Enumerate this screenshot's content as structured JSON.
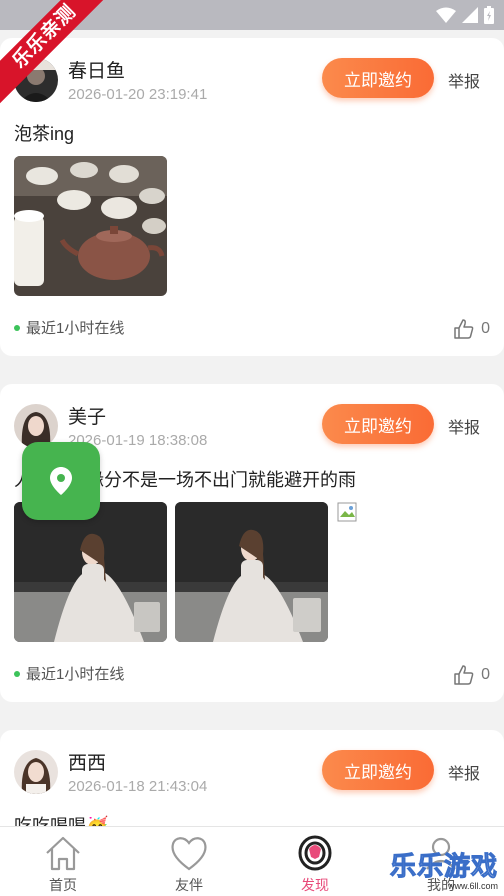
{
  "ribbon": "乐乐亲测",
  "posts": [
    {
      "name": "春日鱼",
      "time": "2026-01-20 23:19:41",
      "invite": "立即邀约",
      "report": "举报",
      "text": "泡茶ing",
      "online": "最近1小时在线",
      "likes": "0"
    },
    {
      "name": "美子",
      "time": "2026-01-19 18:38:08",
      "invite": "立即邀约",
      "report": "举报",
      "text": "人与人的缘分不是一场不出门就能避开的雨",
      "online": "最近1小时在线",
      "likes": "0"
    },
    {
      "name": "西西",
      "time": "2026-01-18 21:43:04",
      "invite": "立即邀约",
      "report": "举报",
      "text": "吃吃喝喝🥳"
    }
  ],
  "tabs": [
    {
      "label": "首页",
      "icon": "home-icon"
    },
    {
      "label": "友伴",
      "icon": "heart-icon"
    },
    {
      "label": "发现",
      "icon": "discover-icon"
    },
    {
      "label": "我的",
      "icon": "profile-icon"
    }
  ],
  "watermark": {
    "text": "乐乐游戏",
    "url": "www.6ll.com"
  },
  "colors": {
    "accent": "#fa6b35",
    "active_tab": "#e84b7a",
    "location_fab": "#46b44f",
    "online_dot": "#3cc35a"
  }
}
